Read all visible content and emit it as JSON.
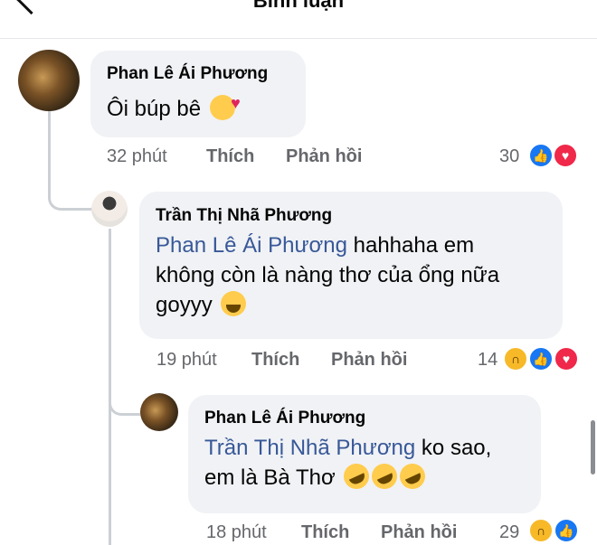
{
  "header": {
    "title": "Bình luận"
  },
  "comments": [
    {
      "author": "Phan Lê Ái Phương",
      "text": "Ôi búp bê",
      "emoji": "smiling-face-with-hearts-emoji",
      "time": "32 phút",
      "like_label": "Thích",
      "reply_label": "Phản hồi",
      "reaction_count": "30",
      "reactions": [
        "like",
        "love"
      ]
    },
    {
      "author": "Trần Thị Nhã Phương",
      "mention": "Phan Lê Ái Phương",
      "text_line1": "hahhaha em",
      "text_line2": "không còn là nàng thơ của ổng nữa",
      "text_line3": "goyyy",
      "emoji": "loudly-crying-face-emoji",
      "time": "19 phút",
      "like_label": "Thích",
      "reply_label": "Phản hồi",
      "reaction_count": "14",
      "reactions": [
        "haha",
        "like",
        "love"
      ]
    },
    {
      "author": "Phan Lê Ái Phương",
      "mention": "Trần Thị Nhã Phương",
      "text_line1": "ko sao,",
      "text_line2": "em là Bà Thơ",
      "emoji": "rolling-on-the-floor-laughing-emoji x3",
      "time": "18 phút",
      "like_label": "Thích",
      "reply_label": "Phản hồi",
      "reaction_count": "29",
      "reactions": [
        "haha",
        "like"
      ]
    }
  ],
  "colors": {
    "like": "#1877f2",
    "love": "#f02849",
    "haha": "#f7b928",
    "mention": "#385898",
    "bubble": "#f0f2f5"
  }
}
